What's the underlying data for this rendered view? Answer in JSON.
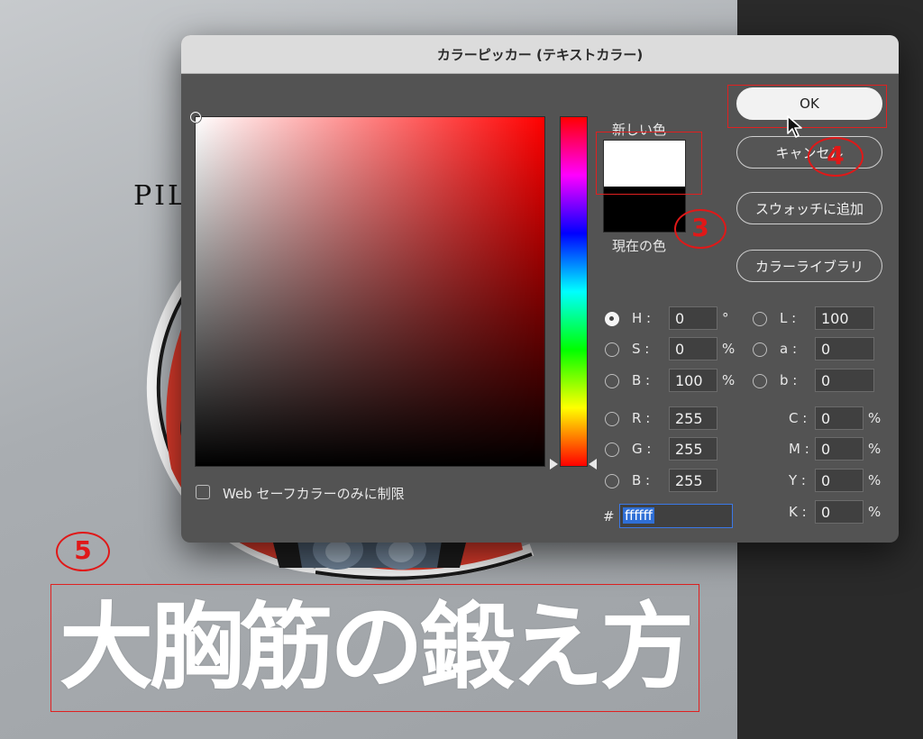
{
  "background": {
    "partial_text": "PIL",
    "title_text": "大胸筋の鍛え方"
  },
  "dialog": {
    "title": "カラーピッカー (テキストカラー)",
    "new_color_label": "新しい色",
    "current_color_label": "現在の色",
    "new_color": "#ffffff",
    "current_color": "#000000",
    "buttons": {
      "ok": "OK",
      "cancel": "キャンセル",
      "add_swatch": "スウォッチに追加",
      "color_libraries": "カラーライブラリ"
    },
    "hsb": [
      {
        "label": "H :",
        "value": "0",
        "unit": "°",
        "selected": true
      },
      {
        "label": "S :",
        "value": "0",
        "unit": "%",
        "selected": false
      },
      {
        "label": "B :",
        "value": "100",
        "unit": "%",
        "selected": false
      }
    ],
    "rgb": [
      {
        "label": "R :",
        "value": "255"
      },
      {
        "label": "G :",
        "value": "255"
      },
      {
        "label": "B :",
        "value": "255"
      }
    ],
    "lab": [
      {
        "label": "L :",
        "value": "100"
      },
      {
        "label": "a :",
        "value": "0"
      },
      {
        "label": "b :",
        "value": "0"
      }
    ],
    "cmyk": [
      {
        "label": "C :",
        "value": "0",
        "unit": "%"
      },
      {
        "label": "M :",
        "value": "0",
        "unit": "%"
      },
      {
        "label": "Y :",
        "value": "0",
        "unit": "%"
      },
      {
        "label": "K :",
        "value": "0",
        "unit": "%"
      }
    ],
    "hex_prefix": "#",
    "hex_value": "ffffff",
    "web_safe_label": "Web セーフカラーのみに制限"
  },
  "annotations": {
    "step3": "3",
    "step4": "4",
    "step5": "5"
  }
}
